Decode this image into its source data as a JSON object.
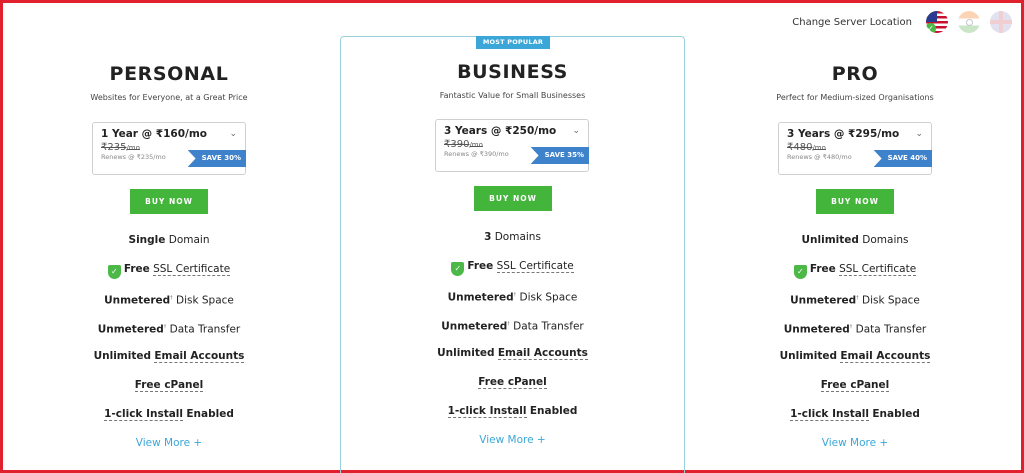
{
  "header": {
    "server_label": "Change Server Location",
    "flags": [
      {
        "icon": "us-flag-icon",
        "selected": true
      },
      {
        "icon": "india-flag-icon",
        "selected": false
      },
      {
        "icon": "uk-flag-icon",
        "selected": false
      }
    ]
  },
  "badge": "MOST POPULAR",
  "plans": [
    {
      "title": "PERSONAL",
      "subtitle": "Websites for Everyone, at a Great Price",
      "price_select": "1 Year @ ₹160/mo",
      "old_price": "₹235",
      "old_unit": "/mo",
      "renews": "Renews @ ₹235/mo",
      "save": "SAVE 30%",
      "buy": "BUY NOW",
      "features": {
        "domains_bold": "Single",
        "domains_text": "Domain",
        "ssl_bold": "Free",
        "ssl_text": "SSL Certificate",
        "disk_bold": "Unmetered",
        "disk_text": "Disk Space",
        "transfer_bold": "Unmetered",
        "transfer_text": "Data Transfer",
        "email_bold": "Unlimited",
        "email_text": "Email Accounts",
        "cpanel": "Free cPanel",
        "install_bold": "1-click Install",
        "install_text": "Enabled"
      },
      "view_more": "View More +"
    },
    {
      "title": "BUSINESS",
      "subtitle": "Fantastic Value for Small Businesses",
      "price_select": "3 Years @ ₹250/mo",
      "old_price": "₹390",
      "old_unit": "/mo",
      "renews": "Renews @ ₹390/mo",
      "save": "SAVE 35%",
      "buy": "BUY NOW",
      "features": {
        "domains_bold": "3",
        "domains_text": "Domains",
        "ssl_bold": "Free",
        "ssl_text": "SSL Certificate",
        "disk_bold": "Unmetered",
        "disk_text": "Disk Space",
        "transfer_bold": "Unmetered",
        "transfer_text": "Data Transfer",
        "email_bold": "Unlimited",
        "email_text": "Email Accounts",
        "cpanel": "Free cPanel",
        "install_bold": "1-click Install",
        "install_text": "Enabled"
      },
      "view_more": "View More +"
    },
    {
      "title": "PRO",
      "subtitle": "Perfect for Medium-sized Organisations",
      "price_select": "3 Years @ ₹295/mo",
      "old_price": "₹480",
      "old_unit": "/mo",
      "renews": "Renews @ ₹480/mo",
      "save": "SAVE 40%",
      "buy": "BUY NOW",
      "features": {
        "domains_bold": "Unlimited",
        "domains_text": "Domains",
        "ssl_bold": "Free",
        "ssl_text": "SSL Certificate",
        "disk_bold": "Unmetered",
        "disk_text": "Disk Space",
        "transfer_bold": "Unmetered",
        "transfer_text": "Data Transfer",
        "email_bold": "Unlimited",
        "email_text": "Email Accounts",
        "cpanel": "Free cPanel",
        "install_bold": "1-click Install",
        "install_text": "Enabled"
      },
      "view_more": "View More +"
    }
  ],
  "colors": {
    "frame": "#e0202c",
    "buy_button": "#44b53b",
    "save_badge": "#3f82cc",
    "link": "#3aa7d8",
    "popular_border": "#9ad0dc"
  }
}
